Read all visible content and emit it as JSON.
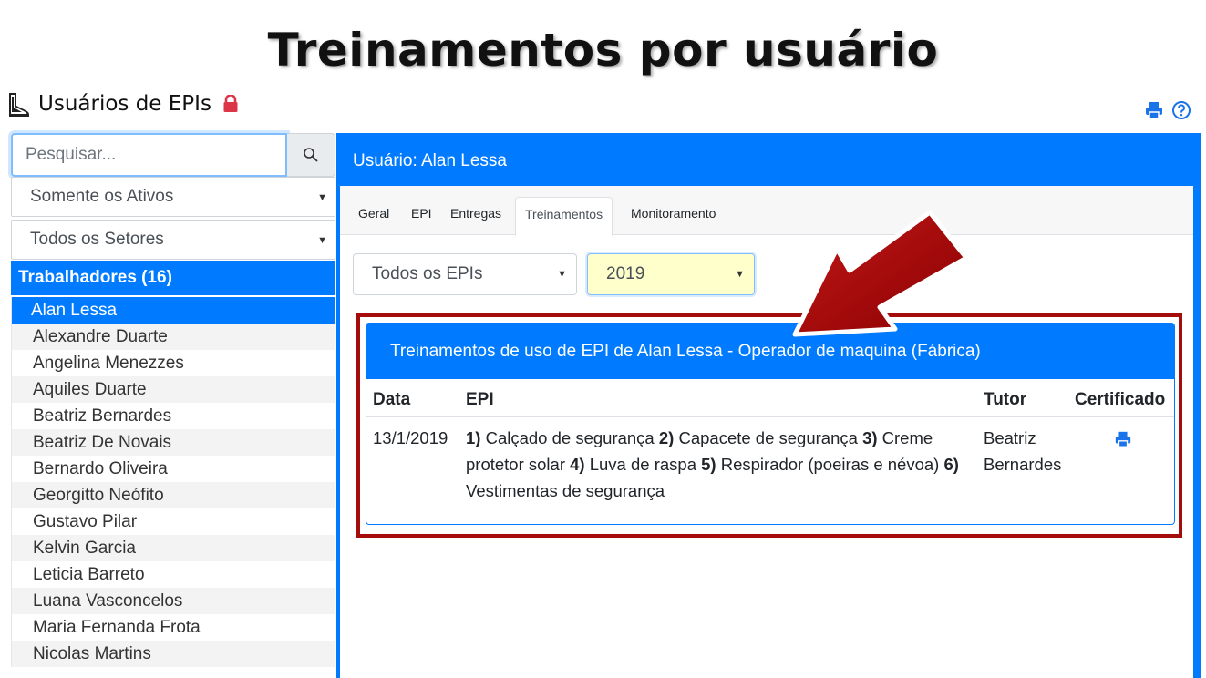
{
  "slide": {
    "title": "Treinamentos por usuário"
  },
  "app": {
    "title": "Usuários de EPIs",
    "icon": "boot-icon",
    "lock_icon": "lock-icon"
  },
  "toolbar": {
    "print_icon": "print-icon",
    "help_icon": "help-icon"
  },
  "sidebar": {
    "search": {
      "placeholder": "Pesquisar...",
      "value": ""
    },
    "status_filter": "Somente os Ativos",
    "sector_filter": "Todos os Setores",
    "workers_header": "Trabalhadores (16)",
    "workers": [
      "Alan Lessa",
      "Alexandre Duarte",
      "Angelina Menezzes",
      "Aquiles Duarte",
      "Beatriz Bernardes",
      "Beatriz De Novais",
      "Bernardo Oliveira",
      "Georgitto Neófito",
      "Gustavo Pilar",
      "Kelvin Garcia",
      "Leticia Barreto",
      "Luana Vasconcelos",
      "Maria Fernanda Frota",
      "Nicolas Martins"
    ],
    "selected_worker": "Alan Lessa"
  },
  "main": {
    "title": "Usuário: Alan Lessa",
    "tabs": [
      {
        "label": "Geral",
        "active": false
      },
      {
        "label": "EPI",
        "active": false
      },
      {
        "label": "Entregas",
        "active": false
      },
      {
        "label": "Treinamentos",
        "active": true
      },
      {
        "label": "Monitoramento",
        "active": false
      }
    ],
    "epi_filter": "Todos os EPIs",
    "year_filter": "2019",
    "card": {
      "title": "Treinamentos de uso de EPI de Alan Lessa - Operador de maquina (Fábrica)",
      "columns": {
        "date": "Data",
        "epi": "EPI",
        "tutor": "Tutor",
        "certificate": "Certificado"
      },
      "rows": [
        {
          "date": "13/1/2019",
          "epis": [
            {
              "n": "1)",
              "name": "Calçado de segurança"
            },
            {
              "n": "2)",
              "name": "Capacete de segurança"
            },
            {
              "n": "3)",
              "name": "Creme protetor solar"
            },
            {
              "n": "4)",
              "name": "Luva de raspa"
            },
            {
              "n": "5)",
              "name": "Respirador (poeiras e névoa)"
            },
            {
              "n": "6)",
              "name": "Vestimentas de segurança"
            }
          ],
          "tutor": "Beatriz Bernardes",
          "certificate_icon": "print-icon"
        }
      ]
    }
  },
  "colors": {
    "primary": "#007bff",
    "highlight": "#a50d0d",
    "year_bg": "#ffffcc"
  }
}
